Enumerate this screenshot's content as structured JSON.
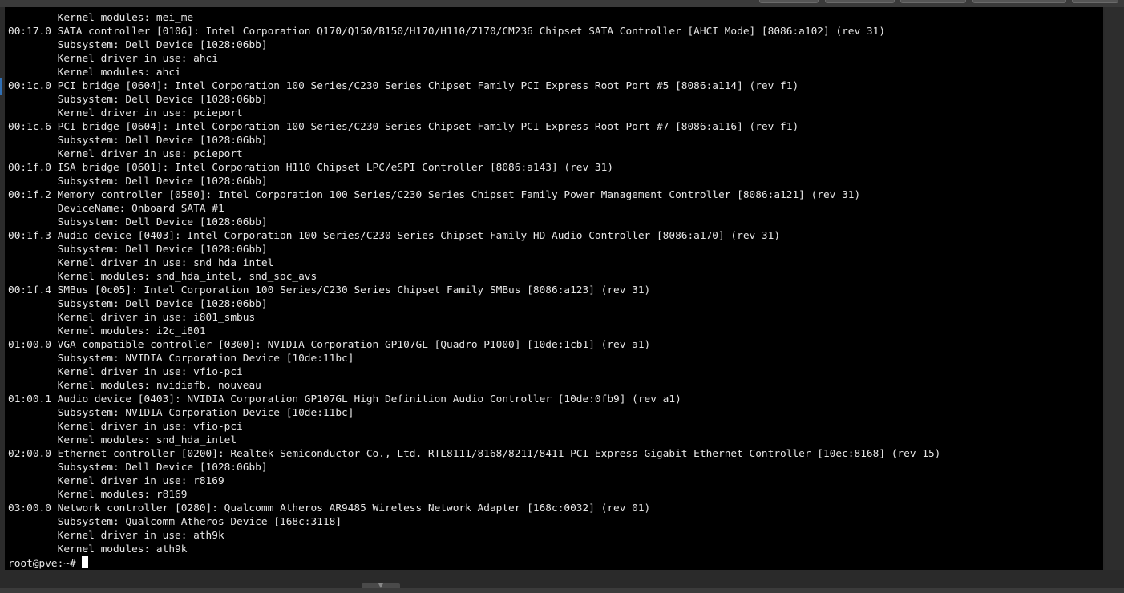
{
  "terminal": {
    "lines": [
      "        Kernel modules: mei_me",
      "00:17.0 SATA controller [0106]: Intel Corporation Q170/Q150/B150/H170/H110/Z170/CM236 Chipset SATA Controller [AHCI Mode] [8086:a102] (rev 31)",
      "        Subsystem: Dell Device [1028:06bb]",
      "        Kernel driver in use: ahci",
      "        Kernel modules: ahci",
      "00:1c.0 PCI bridge [0604]: Intel Corporation 100 Series/C230 Series Chipset Family PCI Express Root Port #5 [8086:a114] (rev f1)",
      "        Subsystem: Dell Device [1028:06bb]",
      "        Kernel driver in use: pcieport",
      "00:1c.6 PCI bridge [0604]: Intel Corporation 100 Series/C230 Series Chipset Family PCI Express Root Port #7 [8086:a116] (rev f1)",
      "        Subsystem: Dell Device [1028:06bb]",
      "        Kernel driver in use: pcieport",
      "00:1f.0 ISA bridge [0601]: Intel Corporation H110 Chipset LPC/eSPI Controller [8086:a143] (rev 31)",
      "        Subsystem: Dell Device [1028:06bb]",
      "00:1f.2 Memory controller [0580]: Intel Corporation 100 Series/C230 Series Chipset Family Power Management Controller [8086:a121] (rev 31)",
      "        DeviceName: Onboard SATA #1",
      "        Subsystem: Dell Device [1028:06bb]",
      "00:1f.3 Audio device [0403]: Intel Corporation 100 Series/C230 Series Chipset Family HD Audio Controller [8086:a170] (rev 31)",
      "        Subsystem: Dell Device [1028:06bb]",
      "        Kernel driver in use: snd_hda_intel",
      "        Kernel modules: snd_hda_intel, snd_soc_avs",
      "00:1f.4 SMBus [0c05]: Intel Corporation 100 Series/C230 Series Chipset Family SMBus [8086:a123] (rev 31)",
      "        Subsystem: Dell Device [1028:06bb]",
      "        Kernel driver in use: i801_smbus",
      "        Kernel modules: i2c_i801",
      "01:00.0 VGA compatible controller [0300]: NVIDIA Corporation GP107GL [Quadro P1000] [10de:1cb1] (rev a1)",
      "        Subsystem: NVIDIA Corporation Device [10de:11bc]",
      "        Kernel driver in use: vfio-pci",
      "        Kernel modules: nvidiafb, nouveau",
      "01:00.1 Audio device [0403]: NVIDIA Corporation GP107GL High Definition Audio Controller [10de:0fb9] (rev a1)",
      "        Subsystem: NVIDIA Corporation Device [10de:11bc]",
      "        Kernel driver in use: vfio-pci",
      "        Kernel modules: snd_hda_intel",
      "02:00.0 Ethernet controller [0200]: Realtek Semiconductor Co., Ltd. RTL8111/8168/8211/8411 PCI Express Gigabit Ethernet Controller [10ec:8168] (rev 15)",
      "        Subsystem: Dell Device [1028:06bb]",
      "        Kernel driver in use: r8169",
      "        Kernel modules: r8169",
      "03:00.0 Network controller [0280]: Qualcomm Atheros AR9485 Wireless Network Adapter [168c:0032] (rev 01)",
      "        Subsystem: Qualcomm Atheros Device [168c:3118]",
      "        Kernel driver in use: ath9k",
      "        Kernel modules: ath9k"
    ],
    "prompt": "root@pve:~# ",
    "colors": {
      "background": "#000000",
      "foreground": "#e6e6e6",
      "cursor": "#ffffff"
    }
  }
}
